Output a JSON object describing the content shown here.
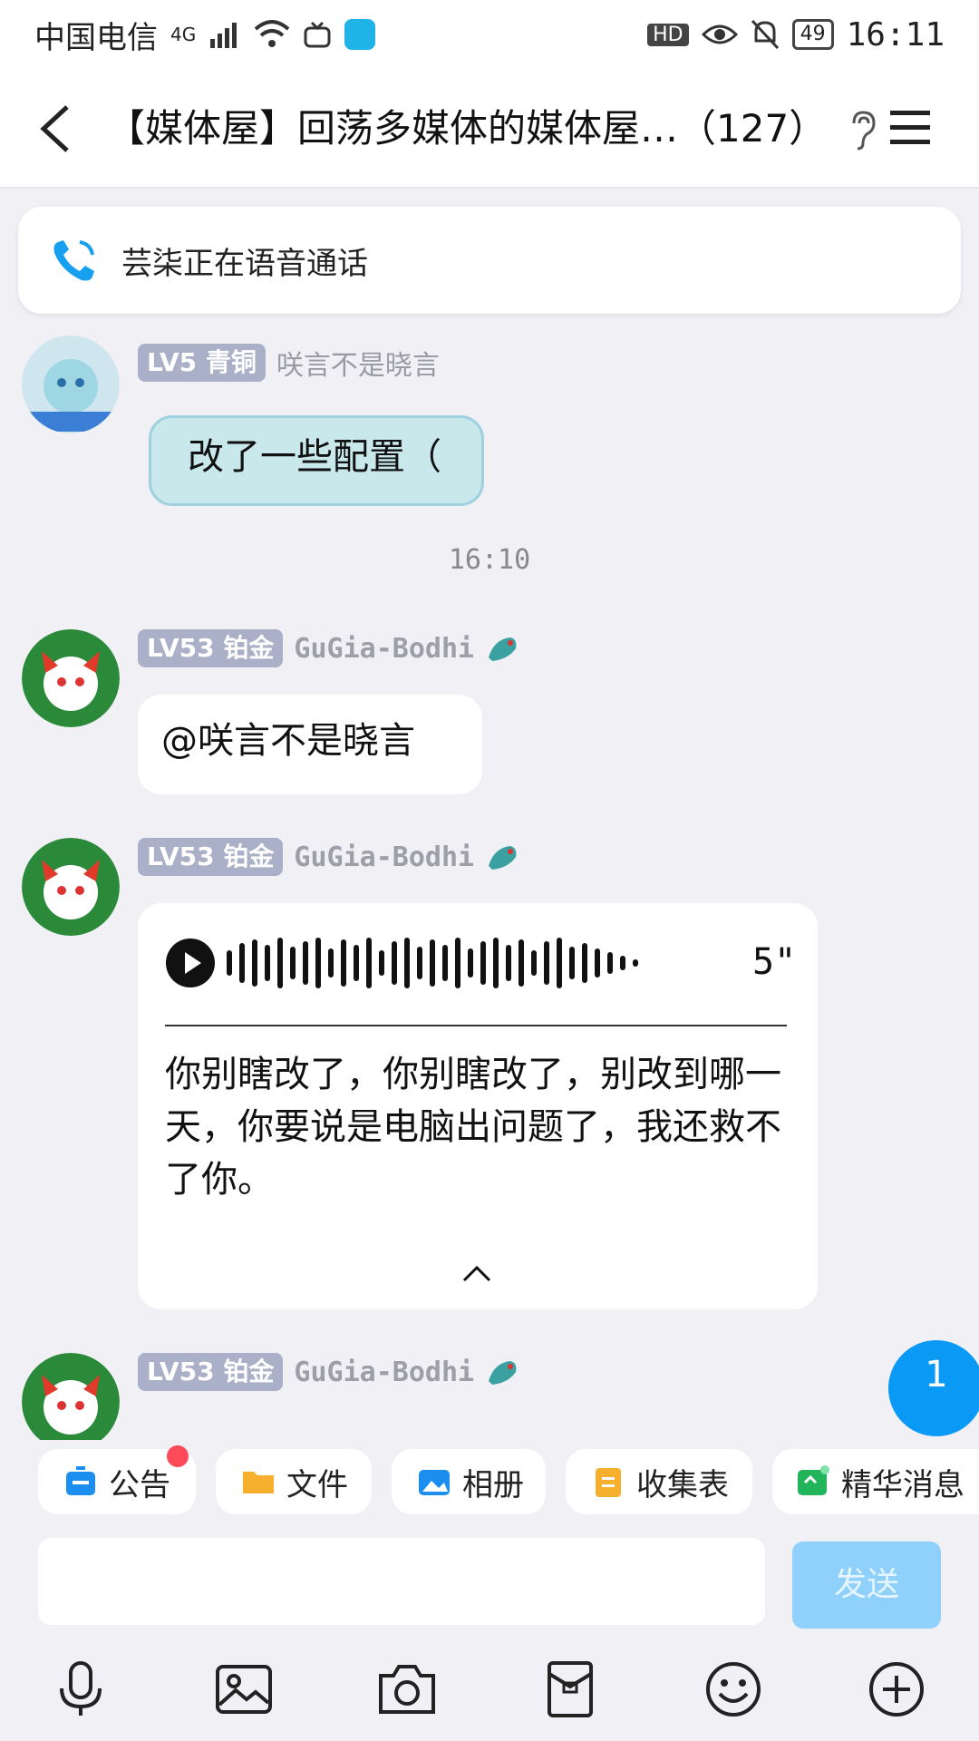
{
  "status_bar": {
    "carrier": "中国电信",
    "network": "4G",
    "badges": [
      "HD"
    ],
    "battery": "49",
    "time": "16:11"
  },
  "header": {
    "title": "【媒体屋】回荡多媒体的媒体屋…（127）",
    "icons": [
      "back-arrow-icon",
      "ear-icon",
      "menu-icon"
    ]
  },
  "call_banner": {
    "text": "芸柒正在语音通话"
  },
  "messages": [
    {
      "level": "LV5",
      "rank": "青铜",
      "sender": "咲言不是晓言",
      "text": "改了一些配置（"
    }
  ],
  "timestamp": "16:10",
  "messages2": [
    {
      "level": "LV53",
      "rank": "铂金",
      "sender": "GuGia-Bodhi",
      "text": "@咲言不是晓言"
    },
    {
      "level": "LV53",
      "rank": "铂金",
      "sender": "GuGia-Bodhi",
      "voice_duration": "5\"",
      "transcript": "你别瞎改了，你别瞎改了，别改到哪一天，你要说是电脑出问题了，我还救不了你。"
    },
    {
      "level": "LV53",
      "rank": "铂金",
      "sender": "GuGia-Bodhi"
    }
  ],
  "unread_count": "1",
  "toolbar": {
    "items": [
      "公告",
      "文件",
      "相册",
      "收集表",
      "精华消息"
    ]
  },
  "input": {
    "placeholder": "",
    "send_label": "发送"
  },
  "bottom_icons": [
    "microphone-icon",
    "image-icon",
    "camera-icon",
    "red-packet-icon",
    "emoji-icon",
    "plus-icon"
  ],
  "colors": {
    "accent": "#0a99f5",
    "send_disabled": "#8fd1fb",
    "badge": "#a9b0c7",
    "red_dot": "#ff4a5a"
  }
}
